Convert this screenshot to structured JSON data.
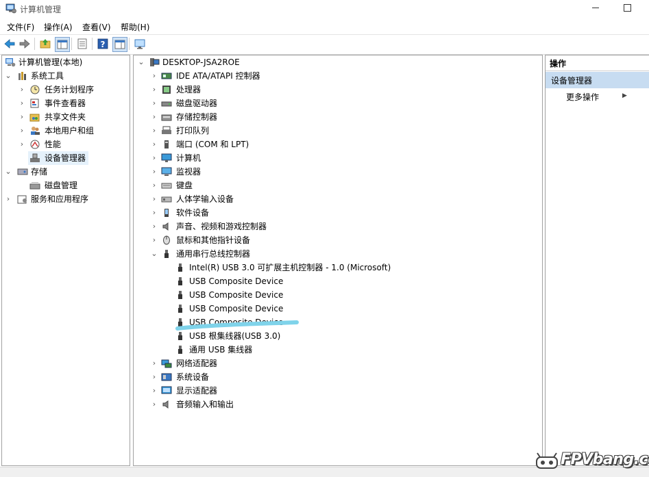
{
  "window": {
    "title": "计算机管理",
    "icon": "computer-management-icon"
  },
  "menubar": {
    "items": [
      "文件(F)",
      "操作(A)",
      "查看(V)",
      "帮助(H)"
    ]
  },
  "toolbar": {
    "buttons": [
      "back-arrow-icon",
      "forward-arrow-icon",
      "up-folder-icon",
      "show-hide-tree-icon",
      "properties-icon",
      "help-icon",
      "action-pane-icon",
      "monitor-icon"
    ]
  },
  "left_tree": {
    "root": "计算机管理(本地)",
    "system_tools": "系统工具",
    "task_scheduler": "任务计划程序",
    "event_viewer": "事件查看器",
    "shared_folders": "共享文件夹",
    "local_users": "本地用户和组",
    "performance": "性能",
    "device_manager": "设备管理器",
    "storage": "存储",
    "disk_management": "磁盘管理",
    "services_apps": "服务和应用程序"
  },
  "device_tree": {
    "computer_name": "DESKTOP-JSA2ROE",
    "categories": [
      {
        "label": "IDE ATA/ATAPI 控制器",
        "icon": "ide-controller-icon",
        "expanded": false
      },
      {
        "label": "处理器",
        "icon": "processor-icon",
        "expanded": false
      },
      {
        "label": "磁盘驱动器",
        "icon": "disk-drive-icon",
        "expanded": false
      },
      {
        "label": "存储控制器",
        "icon": "storage-controller-icon",
        "expanded": false
      },
      {
        "label": "打印队列",
        "icon": "printer-icon",
        "expanded": false
      },
      {
        "label": "端口 (COM 和 LPT)",
        "icon": "port-icon",
        "expanded": false
      },
      {
        "label": "计算机",
        "icon": "computer-icon",
        "expanded": false
      },
      {
        "label": "监视器",
        "icon": "monitor-icon",
        "expanded": false
      },
      {
        "label": "键盘",
        "icon": "keyboard-icon",
        "expanded": false
      },
      {
        "label": "人体学输入设备",
        "icon": "hid-icon",
        "expanded": false
      },
      {
        "label": "软件设备",
        "icon": "software-device-icon",
        "expanded": false
      },
      {
        "label": "声音、视频和游戏控制器",
        "icon": "sound-icon",
        "expanded": false
      },
      {
        "label": "鼠标和其他指针设备",
        "icon": "mouse-icon",
        "expanded": false
      },
      {
        "label": "通用串行总线控制器",
        "icon": "usb-icon",
        "expanded": true
      }
    ],
    "usb_children": [
      "Intel(R) USB 3.0 可扩展主机控制器 - 1.0 (Microsoft)",
      "USB Composite Device",
      "USB Composite Device",
      "USB Composite Device",
      "USB Composite Device",
      "USB 根集线器(USB 3.0)",
      "通用 USB 集线器"
    ],
    "categories_after": [
      {
        "label": "网络适配器",
        "icon": "network-adapter-icon"
      },
      {
        "label": "系统设备",
        "icon": "system-device-icon"
      },
      {
        "label": "显示适配器",
        "icon": "display-adapter-icon"
      },
      {
        "label": "音频输入和输出",
        "icon": "audio-io-icon"
      }
    ]
  },
  "actions_pane": {
    "header": "操作",
    "section": "设备管理器",
    "more": "更多操作",
    "more_arrow": "▶"
  },
  "watermark": {
    "text": "FPVbang.com"
  },
  "colors": {
    "selected_bg": "#e5f1fb",
    "actions_section_bg": "#c7dcf1",
    "scribble": "#7fd3ea"
  }
}
